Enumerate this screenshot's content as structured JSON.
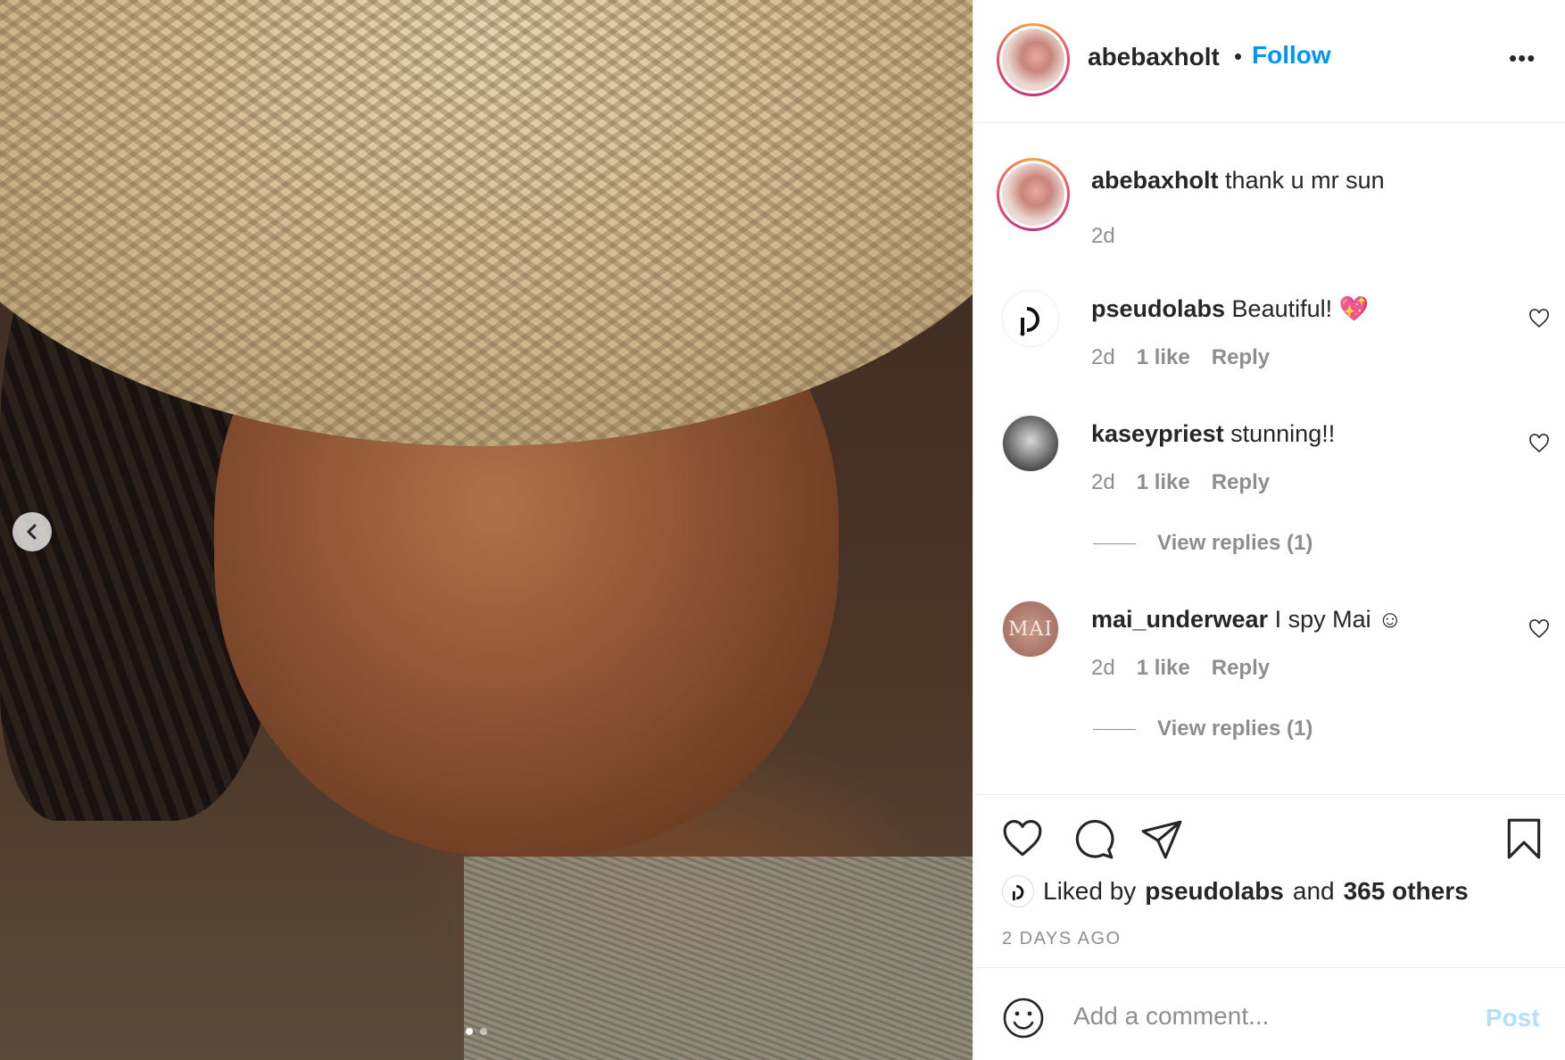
{
  "post": {
    "author": "abebaxholt",
    "separator": "•",
    "follow_label": "Follow",
    "more_label": "•••",
    "caption": {
      "username": "abebaxholt",
      "text": "thank u mr sun",
      "time": "2d"
    },
    "carousel": {
      "current_index": 1,
      "total": 2
    }
  },
  "comments": [
    {
      "username": "pseudolabs",
      "text": "Beautiful! 💖",
      "time": "2d",
      "likes": "1 like",
      "reply_label": "Reply",
      "view_replies": ""
    },
    {
      "username": "kaseypriest",
      "text": "stunning!!",
      "time": "2d",
      "likes": "1 like",
      "reply_label": "Reply",
      "view_replies": "View replies (1)"
    },
    {
      "username": "mai_underwear",
      "text": "I spy Mai ☺",
      "time": "2d",
      "likes": "1 like",
      "reply_label": "Reply",
      "view_replies": "View replies (1)",
      "avatar_text": "MAI"
    }
  ],
  "likes_summary": {
    "prefix": "Liked by",
    "user": "pseudolabs",
    "and": "and",
    "others": "365 others"
  },
  "timestamp": "2 DAYS AGO",
  "add_comment": {
    "placeholder": "Add a comment...",
    "post_label": "Post"
  },
  "colors": {
    "link_blue": "#0095f6",
    "post_disabled": "#b2dffc",
    "secondary_text": "#8e8e8e",
    "primary_text": "#262626"
  }
}
